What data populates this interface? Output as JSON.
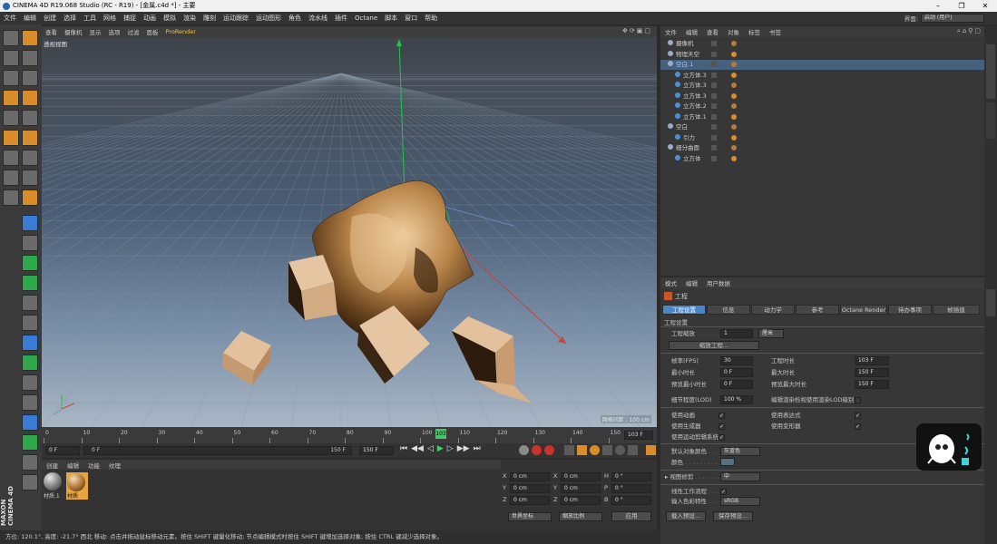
{
  "window": {
    "title": "CINEMA 4D R19.068 Studio (RC - R19) - [金属.c4d *] - 主要",
    "controls": [
      "–",
      "❐",
      "✕"
    ]
  },
  "menu": [
    "文件",
    "编辑",
    "创建",
    "选择",
    "工具",
    "网格",
    "捕捉",
    "动画",
    "模拟",
    "渲染",
    "雕刻",
    "运动跟踪",
    "运动图形",
    "角色",
    "流水线",
    "插件",
    "Octane",
    "脚本",
    "窗口",
    "帮助"
  ],
  "interface": {
    "label": "界面:",
    "value": "启动 (用户)"
  },
  "viewport": {
    "menu": [
      "查看",
      "摄像机",
      "显示",
      "选项",
      "过滤",
      "面板",
      "ProRender"
    ],
    "name": "透视视图",
    "grid_spacing": "网格间距 : 100 cm"
  },
  "timeline": {
    "ticks": [
      "0",
      "10",
      "20",
      "30",
      "40",
      "50",
      "60",
      "70",
      "80",
      "90",
      "100",
      "110",
      "120",
      "130",
      "140",
      "150"
    ],
    "current_frame": "103",
    "end_field": "103 F"
  },
  "transport": {
    "start": "0 F",
    "range_start": "0 F",
    "range_end": "150 F",
    "end": "150 F"
  },
  "materials": {
    "menu": [
      "创建",
      "编辑",
      "功能",
      "纹理"
    ],
    "items": [
      {
        "label": "材质.1",
        "color": "#8a8a8a"
      },
      {
        "label": "材质",
        "color": "#b57b3c"
      }
    ]
  },
  "coords": {
    "rows": [
      {
        "a": "X",
        "av": "0 cm",
        "b": "X",
        "bv": "0 cm",
        "c": "H",
        "cv": "0 °"
      },
      {
        "a": "Y",
        "av": "0 cm",
        "b": "Y",
        "bv": "0 cm",
        "c": "P",
        "cv": "0 °"
      },
      {
        "a": "Z",
        "av": "0 cm",
        "b": "Z",
        "bv": "0 cm",
        "c": "B",
        "cv": "0 °"
      }
    ],
    "mode1": "世界坐标",
    "mode2": "缩放比例",
    "apply": "应用"
  },
  "status": "方位: 120.1°, 高度: -21.7° 西北   移动: 点击并拖动鼠标移动元素。按住 SHIFT 键量化移动; 节点编辑模式时按住 SHIFT 键增加选择对象; 按住 CTRL 键减少选择对象。",
  "objects": {
    "menu": [
      "文件",
      "编辑",
      "查看",
      "对象",
      "标签",
      "书签"
    ],
    "items": [
      {
        "name": "摄像机",
        "indent": 0
      },
      {
        "name": "物理天空",
        "indent": 0
      },
      {
        "name": "空白.1",
        "indent": 0
      },
      {
        "name": "立方体.3",
        "indent": 1
      },
      {
        "name": "立方体.3",
        "indent": 1
      },
      {
        "name": "立方体.3",
        "indent": 1
      },
      {
        "name": "立方体.2",
        "indent": 1
      },
      {
        "name": "立方体.1",
        "indent": 1
      },
      {
        "name": "空白",
        "indent": 0
      },
      {
        "name": "引力",
        "indent": 1
      },
      {
        "name": "细分曲面",
        "indent": 0
      },
      {
        "name": "立方体",
        "indent": 1
      }
    ]
  },
  "attributes": {
    "menu": [
      "模式",
      "编辑",
      "用户数据"
    ],
    "title": "工程",
    "tabs": [
      "工程设置",
      "信息",
      "动力学",
      "参考",
      "Octane Render",
      "待办事项",
      "帧插值"
    ],
    "section": "工程设置",
    "scale_label": "工程缩放",
    "scale_value": "1",
    "scale_unit": "厘米",
    "scale_button": "缩放工程...",
    "fields": [
      {
        "l": "帧率(FPS)",
        "v": "30",
        "r": "工程时长",
        "rv": "103 F"
      },
      {
        "l": "最小时长",
        "v": "0 F",
        "r": "最大时长",
        "rv": "150 F"
      },
      {
        "l": "预览最小时长",
        "v": "0 F",
        "r": "预览最大时长",
        "rv": "150 F"
      }
    ],
    "lod_label": "细节程度(LOD)",
    "lod_value": "100 %",
    "lod_right": "编辑渲染检视使用渲染LOD级别",
    "checks_left": [
      "使用动画",
      "使用生成器",
      "使用运动剪辑系统"
    ],
    "checks_right": [
      "使用表达式",
      "使用变形器"
    ],
    "default_color_label": "默认对象颜色",
    "default_color_value": "灰蓝色",
    "color_label": "颜色",
    "view_clip_label": "视图修剪",
    "view_clip_value": "中",
    "linear_label": "线性工作流程",
    "input_color_label": "输入色彩特性",
    "input_color_value": "sRGB",
    "load_preset": "载入预设...",
    "save_preset": "保存预设..."
  },
  "brand": "MAXON CINEMA 4D"
}
